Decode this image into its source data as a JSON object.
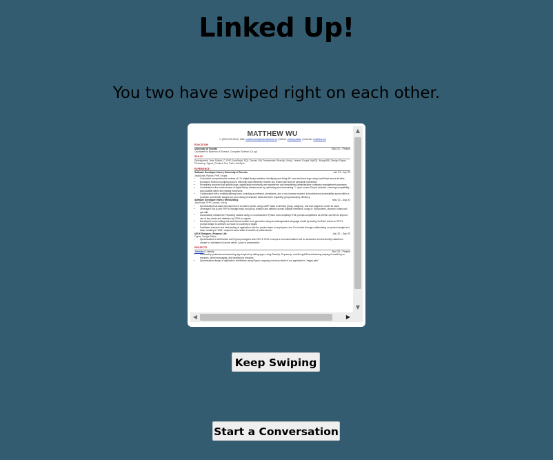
{
  "header": {
    "title": "Linked Up!",
    "subtitle": "You two have swiped right on each other."
  },
  "resume": {
    "name": "MATTHEW WU",
    "contact_prefix": "+1 (000) 000-0101 | Mail:",
    "email": "matthew.wu@mail.utoronto.ca",
    "github_label": "| GitHub:",
    "github": "yellow-potato",
    "linkedin_label": "| LinkedIn:",
    "linkedin": "matthew-wu",
    "sections": {
      "education": "EDUCATION",
      "skills": "SKILLS",
      "experience": "EXPERIENCE",
      "projects": "PROJECTS"
    },
    "education": {
      "school": "University of Toronto",
      "dates": "Sept '21 – Present",
      "degree": "Candidate for Bachelor of Science, Computer Science (Co-op)"
    },
    "skills": "Development: Java, Python, C, PHP, JavaScript, SQL, Docker, Git | Frameworks: React.js, Vue.js, Laravel, Drupal, MySQL, MongoDB | Design: Figma, Photoshop, Figma | Product: Jira, Trello, HubSpot",
    "jobs": [
      {
        "title": "Software Developer Intern | University of Toronto",
        "dates": "Jan '23 – Apr '23",
        "stack": "JavaScript, Python, PHP, Drupal",
        "bullets": [
          "Conducted comprehensive reviews of 10+ digital library websites, identifying and fixing 40+ new technical bugs using JavaScript across all sites",
          "Enhanced Selenium scripting tools to efficiently and effectively monitor any broken site links off permalink redirection",
          "Proactively resolved high-priority bugs, significantly enhancing user experience and streamlining administrative codebase management processes",
          "Contributed to the enhancement of digital library infrastructure by optimizing and customizing 7+ open-source Drupal modules, ensuring compatibility and usability within the existing framework",
          "Collaborated with a multidisciplinary team, including a professor, developers, and a non-invasive student, to troubleshoot accessibility issues within a provision and identify integral pre-processing mechanism flaws that were impacting (pre)processing efficiency"
        ]
      },
      {
        "title": "Software Developer Intern | Weneuniting",
        "dates": "May '22 – Aug '22",
        "stack": "JavaScript, PHP, Laravel, Vue.js",
        "bullets": [
          "Spearheaded full-stack development of an admin portal, using LAMP stack to develop group, subgroup, and user pages for under 2k users",
          "Leveraged Vue.js and PHP to manage back-end group creation and deletion across multiple interfaces, using 4+ components, dynamic routes and api calls",
          "Successfully created the Financing module using CLI commands in Python and compiling HTML prompt-completions as JSON Line files to improve use of key words and statistics by 200% in outputs",
          "Developed a new writing tool and resume builder form generator using an autoregressive language model by testing YouTube videos in GPT-3 prompt design to optimize our tools for a variety of inputs",
          "Facilitated research and beta-testing of application with the product team to employees, and Co-founder through collaborating on product design and strat, resulting in 100k+ acquired users within 6 months of public launch"
        ]
      },
      {
        "title": "UI/UX Designer | Purpose Life",
        "dates": "July '20 – Sep '20",
        "stack": "Figma, Google Slides",
        "bullets": [
          "Spearheaded UI wireframes and Figma prototypes with CEO & COO to scope a recommendation tool for customers to best identify charities to donate to, estimated to launch within 1 year of presentation"
        ]
      }
    ],
    "project": {
      "name": "Jemtube",
      "stack": "| Linkedly",
      "dates": "Nov '23 – Present",
      "bullets": [
        "Co-develop professional networking app inspired by dating apps, using React.js, Express.js, and MongoDB and featuring swiping & matching on resumes, direct messaging, and viewing top resumes",
        "Spearheaded design of application wireframes using Figma, mapping out every detail of our application's \"happy path\""
      ]
    }
  },
  "actions": {
    "keep_swiping": "Keep Swiping",
    "start_conversation": "Start a Conversation"
  },
  "colors": {
    "background": "#345c71",
    "section_heading": "#b71c1c",
    "link": "#1a3fb5",
    "button_bg": "#efefef"
  },
  "icons": {
    "scroll_up": "triangle-up-icon",
    "scroll_down": "triangle-down-icon",
    "scroll_left": "triangle-left-icon",
    "scroll_right": "triangle-right-icon"
  }
}
